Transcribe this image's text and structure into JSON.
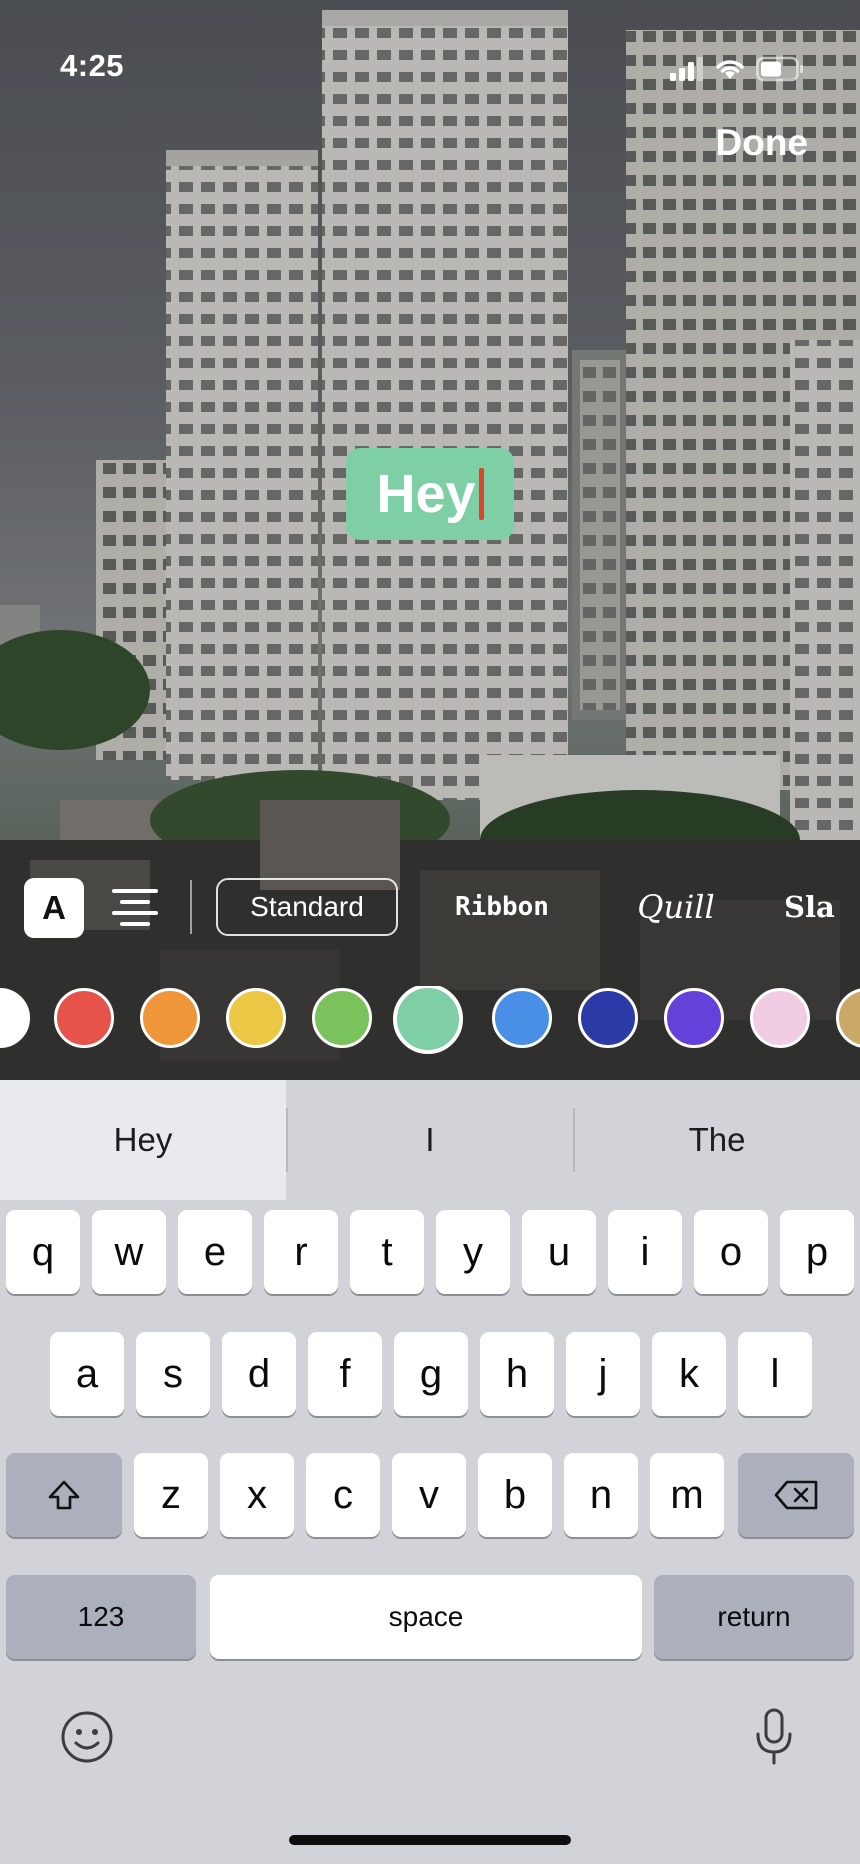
{
  "status": {
    "time": "4:25",
    "signal_icon": "cellular-signal-icon",
    "wifi_icon": "wifi-icon",
    "battery_icon": "battery-icon"
  },
  "header": {
    "done_label": "Done"
  },
  "story_text": {
    "value": "Hey",
    "background_color": "#7ecfa5",
    "caret_color": "#e0432a"
  },
  "font_toolbar": {
    "text_style_label": "A",
    "align_icon": "align-center-icon",
    "fonts": [
      "Standard",
      "Ribbon",
      "Quill",
      "Sla"
    ],
    "selected_font": "Standard"
  },
  "colors": {
    "swatches": [
      "#ffffff",
      "#e5534b",
      "#f0963a",
      "#ecc645",
      "#79c25c",
      "#7ecfa5",
      "#4a8fe6",
      "#2c3aa8",
      "#6442d9",
      "#f0cde3",
      "#c9a868"
    ],
    "selected": "#7ecfa5"
  },
  "keyboard": {
    "predictions": [
      "Hey",
      "I",
      "The"
    ],
    "row1": [
      "q",
      "w",
      "e",
      "r",
      "t",
      "y",
      "u",
      "i",
      "o",
      "p"
    ],
    "row2": [
      "a",
      "s",
      "d",
      "f",
      "g",
      "h",
      "j",
      "k",
      "l"
    ],
    "row3": [
      "z",
      "x",
      "c",
      "v",
      "b",
      "n",
      "m"
    ],
    "shift_icon": "shift-icon",
    "delete_icon": "delete-icon",
    "numbers_label": "123",
    "space_label": "space",
    "return_label": "return",
    "emoji_icon": "emoji-icon",
    "mic_icon": "microphone-icon"
  }
}
